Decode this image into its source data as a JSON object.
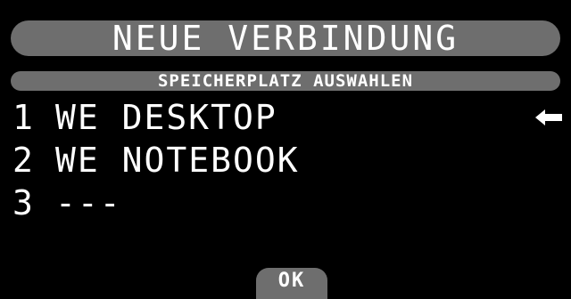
{
  "header": {
    "title": "NEUE VERBINDUNG",
    "subtitle": "SPEICHERPLATZ AUSWAHLEN"
  },
  "slots": [
    {
      "number": "1",
      "label": "WE DESKTOP",
      "selected": true
    },
    {
      "number": "2",
      "label": "WE NOTEBOOK",
      "selected": false
    },
    {
      "number": "3",
      "label": "---",
      "selected": false
    }
  ],
  "selection_indicator_icon": "left-arrow-icon",
  "footer": {
    "ok_label": "OK"
  },
  "colors": {
    "background": "#000000",
    "bar": "#6e6e6e",
    "text": "#ffffff"
  }
}
